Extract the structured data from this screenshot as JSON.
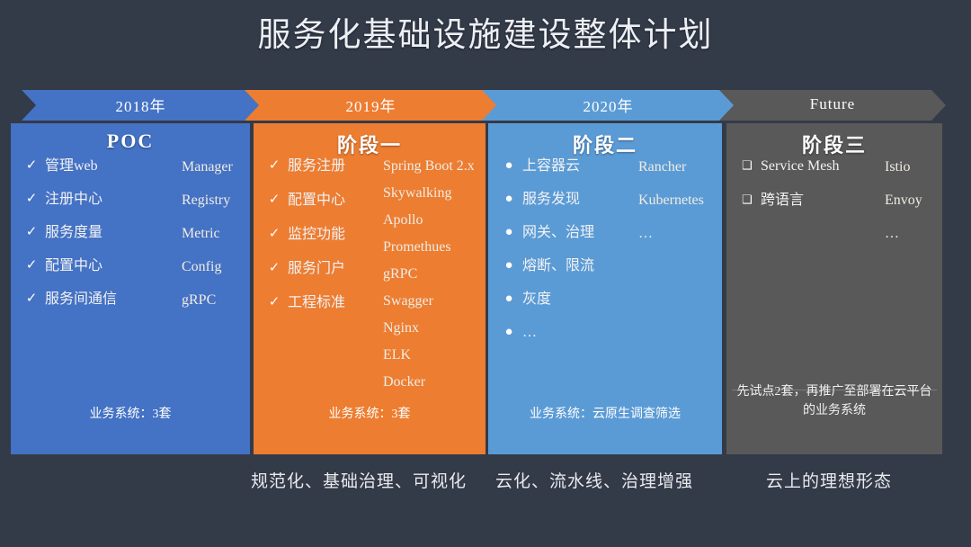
{
  "title": "服务化基础设施建设整体计划",
  "timeline": [
    {
      "label": "2018年",
      "color": "#4472c4"
    },
    {
      "label": "2019年",
      "color": "#ed7d31"
    },
    {
      "label": "2020年",
      "color": "#5b9bd5"
    },
    {
      "label": "Future",
      "color": "#595959"
    }
  ],
  "columns": [
    {
      "title": "POC",
      "marker": "check",
      "marker_glyph": "✓",
      "items": [
        "管理web",
        "注册中心",
        "服务度量",
        "配置中心",
        "服务间通信"
      ],
      "tech": [
        "Manager",
        "Registry",
        "Metric",
        "Config",
        "gRPC"
      ],
      "note": "业务系统：3套",
      "color": "#4472c4"
    },
    {
      "title": "阶段一",
      "marker": "check",
      "marker_glyph": "✓",
      "items": [
        "服务注册",
        "配置中心",
        "监控功能",
        "服务门户",
        "工程标准"
      ],
      "tech": [
        "Spring Boot 2.x",
        "Skywalking",
        "Apollo",
        "Promethues",
        "gRPC",
        "Swagger",
        "Nginx",
        "ELK",
        "Docker"
      ],
      "note": "业务系统：3套",
      "color": "#ed7d31"
    },
    {
      "title": "阶段二",
      "marker": "dot",
      "marker_glyph": "●",
      "items": [
        "上容器云",
        "服务发现",
        "网关、治理",
        "熔断、限流",
        "灰度",
        "…"
      ],
      "tech": [
        "Rancher",
        "Kubernetes",
        "…"
      ],
      "note": "业务系统：云原生调查筛选",
      "color": "#5b9bd5"
    },
    {
      "title": "阶段三",
      "marker": "box",
      "marker_glyph": "❑",
      "items": [
        "Service Mesh",
        "跨语言"
      ],
      "tech": [
        "Istio",
        "Envoy",
        "…"
      ],
      "note": "先试点2套，再推广至部署在云平台的业务系统",
      "color": "#595959"
    }
  ],
  "captions": [
    "规范化、基础治理、可视化",
    "云化、流水线、治理增强",
    "云上的理想形态"
  ],
  "theme": {
    "background": "#333a48",
    "title_color": "#eceff4",
    "tech_color": "#f0ece4"
  }
}
